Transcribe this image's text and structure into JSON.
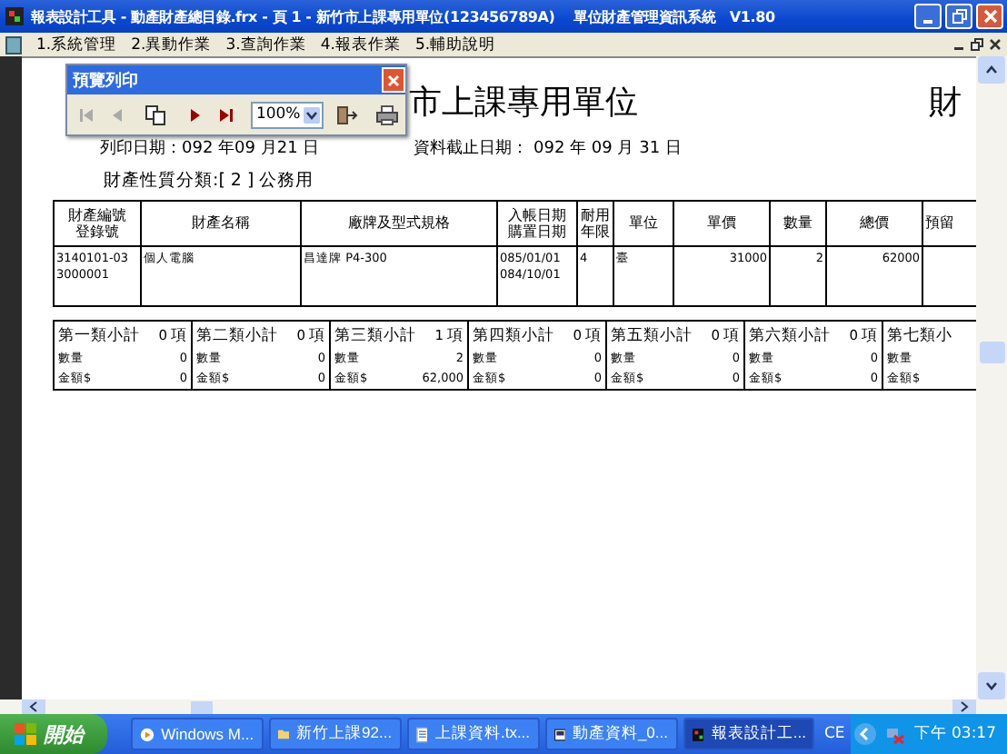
{
  "window": {
    "title": "報表設計工具 - 動產財產總目錄.frx - 頁 1 - 新竹市上課專用單位(123456789A)　 單位財產管理資訊系統　V1.80"
  },
  "menu": [
    "1.系統管理",
    "2.異動作業",
    "3.查詢作業",
    "4.報表作業",
    "5.輔助說明"
  ],
  "preview_toolbar": {
    "title": "預覽列印",
    "zoom": "100%",
    "buttons": [
      {
        "kind": "first",
        "disabled": true
      },
      {
        "kind": "prev",
        "disabled": true
      },
      {
        "kind": "copy",
        "disabled": false
      },
      {
        "kind": "next",
        "disabled": false
      },
      {
        "kind": "last",
        "disabled": false
      },
      {
        "kind": "zoom",
        "disabled": false
      },
      {
        "kind": "exit",
        "disabled": false
      },
      {
        "kind": "print",
        "disabled": false
      }
    ]
  },
  "report": {
    "title": "市上課專用單位",
    "title_right": "財",
    "print_date": "列印日期：092 年09 月21 日",
    "cutoff_date": "資料截止日期： 092 年 09 月 31 日",
    "category": "財產性質分類:[ 2 ] 公務用",
    "table": {
      "columns": [
        "財產編號登錄號",
        "財產名稱",
        "廠牌及型式規格",
        "入帳日期購置日期",
        "耐用年限",
        "單位",
        "單價",
        "數量",
        "總價",
        "預留"
      ],
      "rows": [
        [
          "3140101-03\n3000001",
          "個人電腦",
          "昌達牌 P4-300",
          "085/01/01\n084/10/01",
          "4",
          "臺",
          "31000",
          "2",
          "62000",
          ""
        ]
      ]
    },
    "subtotals": [
      {
        "title": "第一類小計",
        "count": "0",
        "unit": "項",
        "lines": [
          {
            "label": "數量",
            "value": "0"
          },
          {
            "label": "金額$",
            "value": "0"
          }
        ]
      },
      {
        "title": "第二類小計",
        "count": "0",
        "unit": "項",
        "lines": [
          {
            "label": "數量",
            "value": "0"
          },
          {
            "label": "金額$",
            "value": "0"
          }
        ]
      },
      {
        "title": "第三類小計",
        "count": "1",
        "unit": "項",
        "lines": [
          {
            "label": "數量",
            "value": "2"
          },
          {
            "label": "金額$",
            "value": "62,000"
          }
        ]
      },
      {
        "title": "第四類小計",
        "count": "0",
        "unit": "項",
        "lines": [
          {
            "label": "數量",
            "value": "0"
          },
          {
            "label": "金額$",
            "value": "0"
          }
        ]
      },
      {
        "title": "第五類小計",
        "count": "0",
        "unit": "項",
        "lines": [
          {
            "label": "數量",
            "value": "0"
          },
          {
            "label": "金額$",
            "value": "0"
          }
        ]
      },
      {
        "title": "第六類小計",
        "count": "0",
        "unit": "項",
        "lines": [
          {
            "label": "數量",
            "value": "0"
          },
          {
            "label": "金額$",
            "value": "0"
          }
        ]
      },
      {
        "title": "第七類小",
        "lines": [
          {
            "label": "數量"
          },
          {
            "label": "金額$"
          }
        ]
      }
    ]
  },
  "taskbar": {
    "start": "開始",
    "tasks": [
      {
        "kind": "media",
        "label": "Windows M...",
        "selected": false
      },
      {
        "kind": "folder",
        "label": "新竹上課92...",
        "selected": false
      },
      {
        "kind": "text",
        "label": "上課資料.tx...",
        "selected": false
      },
      {
        "kind": "doc",
        "label": "動產資料_0...",
        "selected": false
      },
      {
        "kind": "app",
        "label": "報表設計工...",
        "selected": true
      }
    ],
    "language": "CE",
    "clock": "下午 03:17"
  }
}
